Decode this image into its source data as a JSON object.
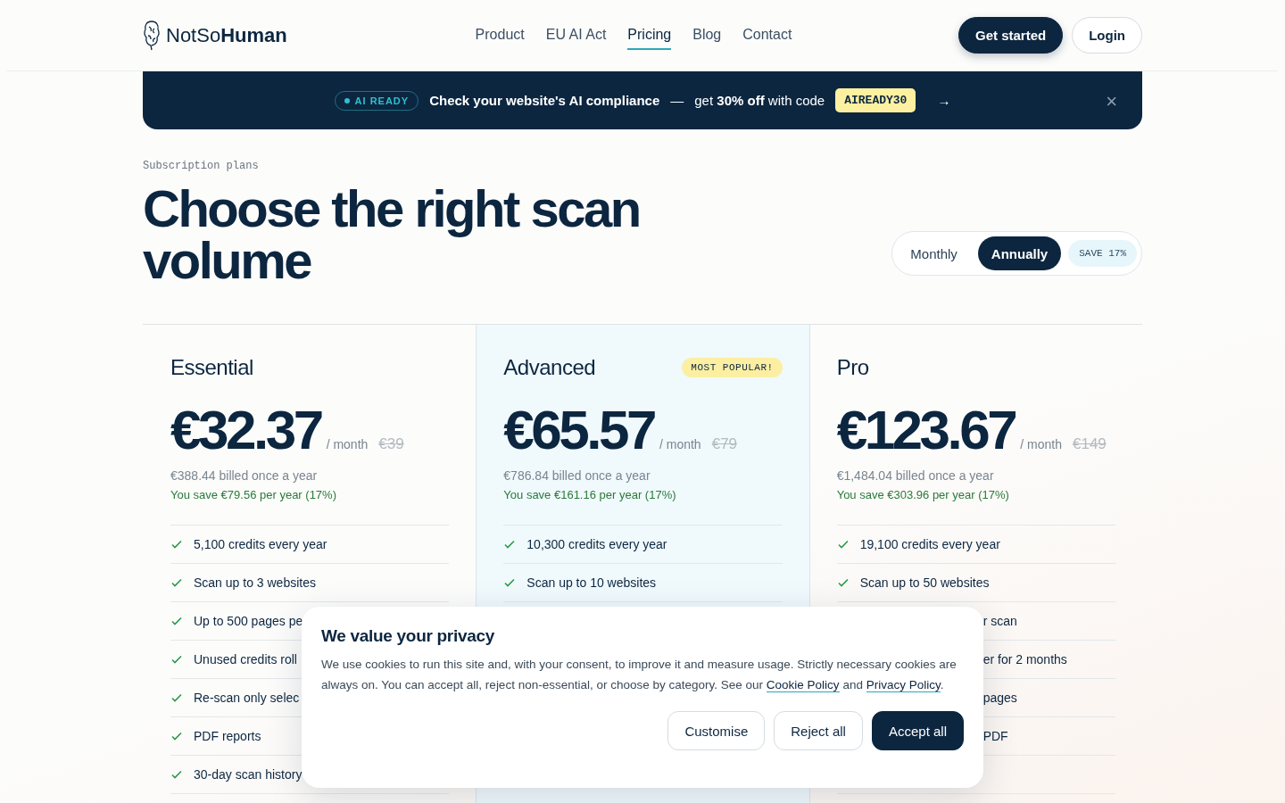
{
  "header": {
    "brand_light": "NotSo",
    "brand_bold": "Human",
    "nav": [
      {
        "label": "Product",
        "selected": false
      },
      {
        "label": "EU AI Act",
        "selected": false
      },
      {
        "label": "Pricing",
        "selected": true
      },
      {
        "label": "Blog",
        "selected": false
      },
      {
        "label": "Contact",
        "selected": false
      }
    ],
    "cta": "Get started",
    "login": "Login"
  },
  "banner": {
    "badge": "AI READY",
    "text": "Check your website's AI compliance",
    "dash": "—",
    "offer_pre": "get",
    "offer_bold": "30% off",
    "offer_post": "with code",
    "code": "AIREADY30",
    "arrow": "→",
    "close": "×"
  },
  "eyebrow": "Subscription plans",
  "title": "Choose the right scan volume",
  "billing": {
    "options": [
      {
        "label": "Monthly",
        "selected": false
      },
      {
        "label": "Annually",
        "selected": true
      }
    ],
    "save": "SAVE 17%"
  },
  "plans": [
    {
      "name": "Essential",
      "highlighted": false,
      "price": "€32.37",
      "per": "/ month",
      "old": "€39",
      "billed": "€388.44 billed once a year",
      "save": "You save €79.56 per year (17%)",
      "features": [
        {
          "text": "5,100 credits every year",
          "kind": "full"
        },
        {
          "text": "Scan up to 3 websites",
          "kind": "full"
        },
        {
          "text": "Up to 500 pages pe",
          "kind": "full"
        },
        {
          "text": "Unused credits roll",
          "kind": "full"
        },
        {
          "text": "Re-scan only selec",
          "kind": "full"
        },
        {
          "text": "PDF reports",
          "kind": "full"
        },
        {
          "text": "30-day scan history",
          "kind": "full"
        }
      ]
    },
    {
      "name": "Advanced",
      "highlighted": true,
      "badge": "MOST POPULAR!",
      "price": "€65.57",
      "per": "/ month",
      "old": "€79",
      "billed": "€786.84 billed once a year",
      "save": "You save €161.16 per year (17%)",
      "features": [
        {
          "text": "10,300 credits every year",
          "kind": "full"
        },
        {
          "text": "Scan up to 10 websites",
          "kind": "full"
        }
      ]
    },
    {
      "name": "Pro",
      "highlighted": false,
      "price": "€123.67",
      "per": "/ month",
      "old": "€149",
      "billed": "€1,484.04 billed once a year",
      "save": "You save €303.96 per year (17%)",
      "features": [
        {
          "text": "19,100 credits every year",
          "kind": "full"
        },
        {
          "text": "Scan up to 50 websites",
          "kind": "full"
        },
        {
          "text": "r scan",
          "kind": "covered"
        },
        {
          "text": "er for 2 months",
          "kind": "covered"
        },
        {
          "text": "pages",
          "kind": "covered"
        },
        {
          "text": "PDF",
          "kind": "covered"
        }
      ]
    }
  ],
  "cookie": {
    "title": "We value your privacy",
    "body": "We use cookies to run this site and, with your consent, to improve it and measure usage. Strictly necessary cookies are always on. You can accept all, reject non-essential, or choose by category. See our",
    "link1": "Cookie Policy",
    "and": "and",
    "link2": "Privacy Policy",
    "end": ".",
    "buttons": [
      {
        "label": "Customise",
        "kind": "outline"
      },
      {
        "label": "Reject all",
        "kind": "outline"
      },
      {
        "label": "Accept all",
        "kind": "primary"
      }
    ]
  }
}
